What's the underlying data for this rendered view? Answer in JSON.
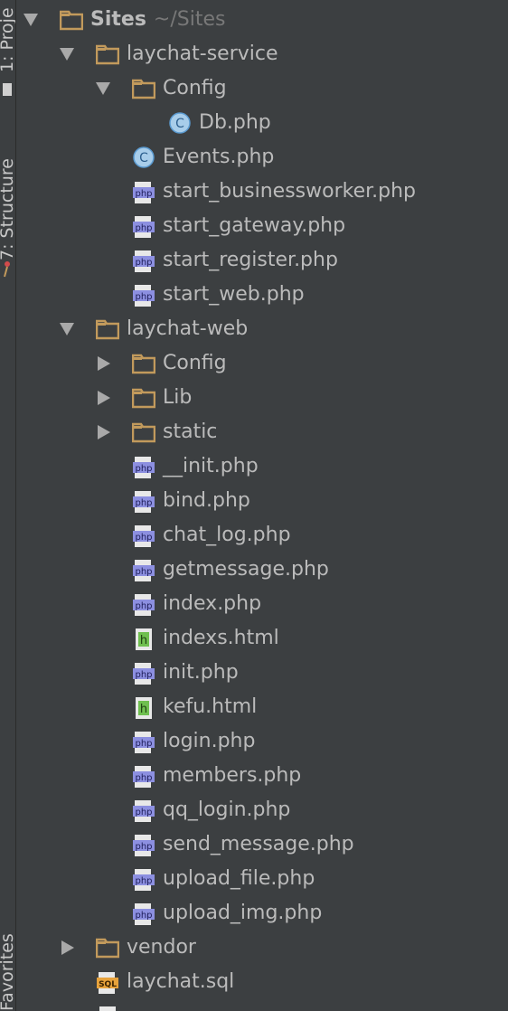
{
  "side_tabs": {
    "project": "1: Proje",
    "structure": "7: Structure",
    "favorites": "Favorites"
  },
  "tree": {
    "root": {
      "name": "Sites",
      "path": "~/Sites"
    },
    "items": [
      {
        "name": "laychat-service"
      },
      {
        "name": "Config"
      },
      {
        "name": "Db.php"
      },
      {
        "name": "Events.php"
      },
      {
        "name": "start_businessworker.php"
      },
      {
        "name": "start_gateway.php"
      },
      {
        "name": "start_register.php"
      },
      {
        "name": "start_web.php"
      },
      {
        "name": "laychat-web"
      },
      {
        "name": "Config"
      },
      {
        "name": "Lib"
      },
      {
        "name": "static"
      },
      {
        "name": "__init.php"
      },
      {
        "name": "bind.php"
      },
      {
        "name": "chat_log.php"
      },
      {
        "name": "getmessage.php"
      },
      {
        "name": "index.php"
      },
      {
        "name": "indexs.html"
      },
      {
        "name": "init.php"
      },
      {
        "name": "kefu.html"
      },
      {
        "name": "login.php"
      },
      {
        "name": "members.php"
      },
      {
        "name": "qq_login.php"
      },
      {
        "name": "send_message.php"
      },
      {
        "name": "upload_file.php"
      },
      {
        "name": "upload_img.php"
      },
      {
        "name": "vendor"
      },
      {
        "name": "laychat.sql"
      }
    ]
  },
  "icon_labels": {
    "php": "php",
    "html": "h",
    "class": "C",
    "sql": "SQL"
  },
  "colors": {
    "background": "#3c3f41",
    "folder": "#c29a5c",
    "php": "#8c8fe0",
    "html": "#6fbf4f",
    "class": "#7fb4e0"
  }
}
